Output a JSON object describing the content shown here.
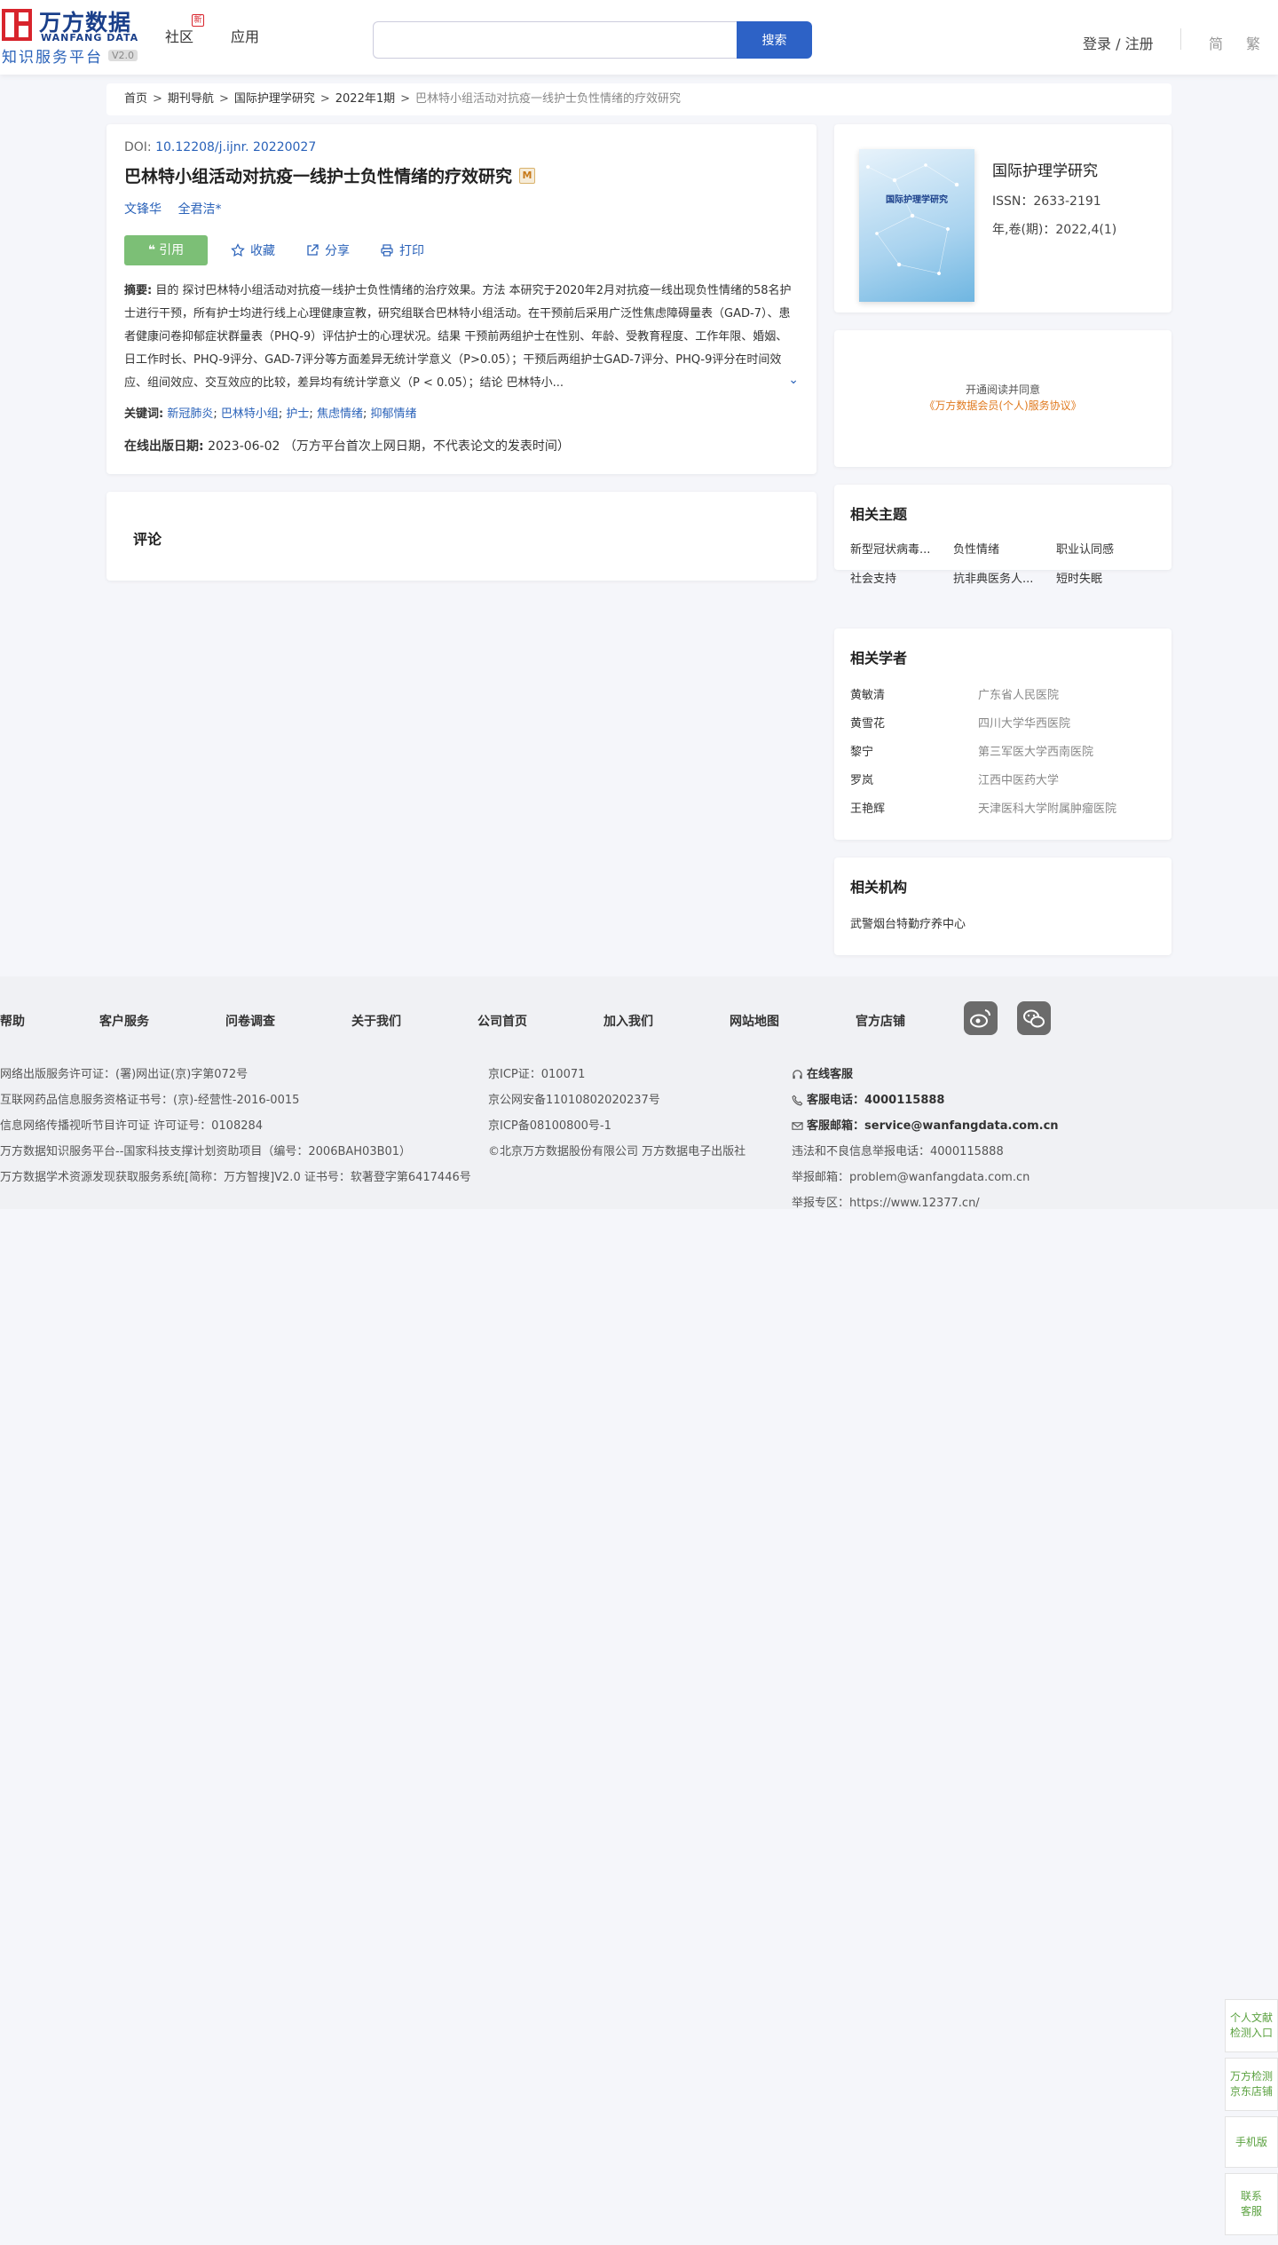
{
  "header": {
    "logo_cn": "万方数据",
    "logo_en": "WANFANG DATA",
    "logo_sub": "知识服务平台",
    "logo_version": "V2.0",
    "nav": [
      {
        "label": "社区"
      },
      {
        "label": "应用"
      }
    ],
    "community_badge": "新",
    "search": {
      "value": "",
      "button": "搜索"
    },
    "login": "登录 / 注册",
    "lang_simplified": "简",
    "lang_traditional": "繁"
  },
  "breadcrumb": {
    "items": [
      "首页",
      "期刊导航",
      "国际护理学研究",
      "2022年1期"
    ],
    "current": "巴林特小组活动对抗疫一线护士负性情绪的疗效研究",
    "separator": ">"
  },
  "article": {
    "doi_label": "DOI:",
    "doi": "10.12208/j.ijnr. 20220027",
    "title": "巴林特小组活动对抗疫一线护士负性情绪的疗效研究",
    "badge": "M",
    "authors": [
      "文锋华",
      "全君洁*"
    ],
    "actions": {
      "cite": "引用",
      "collect": "收藏",
      "share": "分享",
      "print": "打印"
    },
    "abstract_label": "摘要:",
    "abstract": "目的 探讨巴林特小组活动对抗疫一线护士负性情绪的治疗效果。方法 本研究于2020年2月对抗疫一线出现负性情绪的58名护士进行干预，所有护士均进行线上心理健康宣教，研究组联合巴林特小组活动。在干预前后采用广泛性焦虑障碍量表（GAD-7）、患者健康问卷抑郁症状群量表（PHQ-9）评估护士的心理状况。结果 干预前两组护士在性别、年龄、受教育程度、工作年限、婚姻、日工作时长、PHQ-9评分、GAD-7评分等方面差异无统计学意义（P>0.05）；干预后两组护士GAD-7评分、PHQ-9评分在时间效应、组间效应、交互效应的比较，差异均有统计学意义（P < 0.05）；结论 巴林特小...",
    "keywords_label": "关键词:",
    "keywords": [
      "新冠肺炎",
      "巴林特小组",
      "护士",
      "焦虑情绪",
      "抑郁情绪"
    ],
    "pubdate_label": "在线出版日期:",
    "pubdate": "2023-06-02",
    "pubdate_note": "（万方平台首次上网日期，不代表论文的发表时间）"
  },
  "comments": {
    "title": "评论"
  },
  "journal": {
    "cover_title": "国际护理学研究",
    "name": "国际护理学研究",
    "issn": "ISSN：2633-2191",
    "volume": "年,卷(期)：2022,4(1)"
  },
  "membership": {
    "line1": "开通阅读并同意",
    "line2": "《万方数据会员(个人)服务协议》"
  },
  "related_topics": {
    "title": "相关主题",
    "items": [
      "新型冠状病毒...",
      "负性情绪",
      "职业认同感",
      "社会支持",
      "抗非典医务人...",
      "短时失眠"
    ]
  },
  "related_scholars": {
    "title": "相关学者",
    "items": [
      {
        "name": "黄敏清",
        "org": "广东省人民医院"
      },
      {
        "name": "黄雪花",
        "org": "四川大学华西医院"
      },
      {
        "name": "黎宁",
        "org": "第三军医大学西南医院"
      },
      {
        "name": "罗岚",
        "org": "江西中医药大学"
      },
      {
        "name": "王艳辉",
        "org": "天津医科大学附属肿瘤医院"
      }
    ]
  },
  "related_institutions": {
    "title": "相关机构",
    "items": [
      "武警烟台特勤疗养中心"
    ]
  },
  "footer": {
    "nav": [
      "帮助",
      "客户服务",
      "问卷调查",
      "关于我们",
      "公司首页",
      "加入我们",
      "网站地图",
      "官方店铺"
    ],
    "col1": [
      "网络出版服务许可证：(署)网出证(京)字第072号",
      "互联网药品信息服务资格证书号：(京)-经营性-2016-0015",
      "信息网络传播视听节目许可证 许可证号：0108284",
      "万方数据知识服务平台--国家科技支撑计划资助项目（编号：2006BAH03B01）",
      "万方数据学术资源发现获取服务系统[简称：万方智搜]V2.0 证书号：软著登字第6417446号"
    ],
    "col2": [
      "京ICP证：010071",
      "京公网安备11010802020237号",
      "京ICP备08100800号-1",
      "©北京万方数据股份有限公司 万方数据电子出版社"
    ],
    "col3": {
      "online": "在线客服",
      "phone_label": "客服电话：",
      "phone": "4000115888",
      "email_label": "客服邮箱：",
      "email": "service@wanfangdata.com.cn",
      "report_phone": "违法和不良信息举报电话：4000115888",
      "report_email": "举报邮箱：problem@wanfangdata.com.cn",
      "report_zone": "举报专区：https://www.12377.cn/"
    }
  },
  "float_buttons": [
    "个人文献检测入口",
    "万方检测京东店铺",
    "手机版",
    "联系客服"
  ]
}
